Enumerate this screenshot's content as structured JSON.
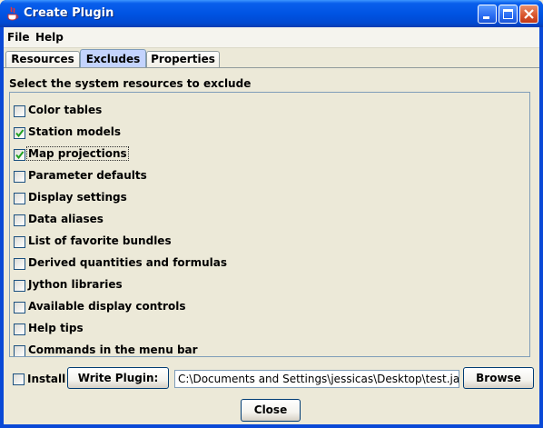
{
  "window": {
    "title": "Create Plugin"
  },
  "menubar": {
    "items": [
      {
        "label": "File"
      },
      {
        "label": "Help"
      }
    ]
  },
  "tabs": [
    {
      "label": "Resources",
      "active": false
    },
    {
      "label": "Excludes",
      "active": true
    },
    {
      "label": "Properties",
      "active": false
    }
  ],
  "excludes": {
    "heading": "Select the system resources to exclude",
    "items": [
      {
        "label": "Color tables",
        "checked": false
      },
      {
        "label": "Station models",
        "checked": true
      },
      {
        "label": "Map projections",
        "checked": true
      },
      {
        "label": "Parameter defaults",
        "checked": false
      },
      {
        "label": "Display settings",
        "checked": false
      },
      {
        "label": "Data aliases",
        "checked": false
      },
      {
        "label": "List of favorite bundles",
        "checked": false
      },
      {
        "label": "Derived quantities and formulas",
        "checked": false
      },
      {
        "label": "Jython libraries",
        "checked": false
      },
      {
        "label": "Available display controls",
        "checked": false
      },
      {
        "label": "Help tips",
        "checked": false
      },
      {
        "label": "Commands in the menu bar",
        "checked": false
      }
    ]
  },
  "bottom": {
    "install_label": "Install",
    "install_checked": false,
    "write_plugin_label": "Write Plugin:",
    "path_value": "C:\\Documents and Settings\\jessicas\\Desktop\\test.jar",
    "browse_label": "Browse",
    "close_label": "Close"
  }
}
